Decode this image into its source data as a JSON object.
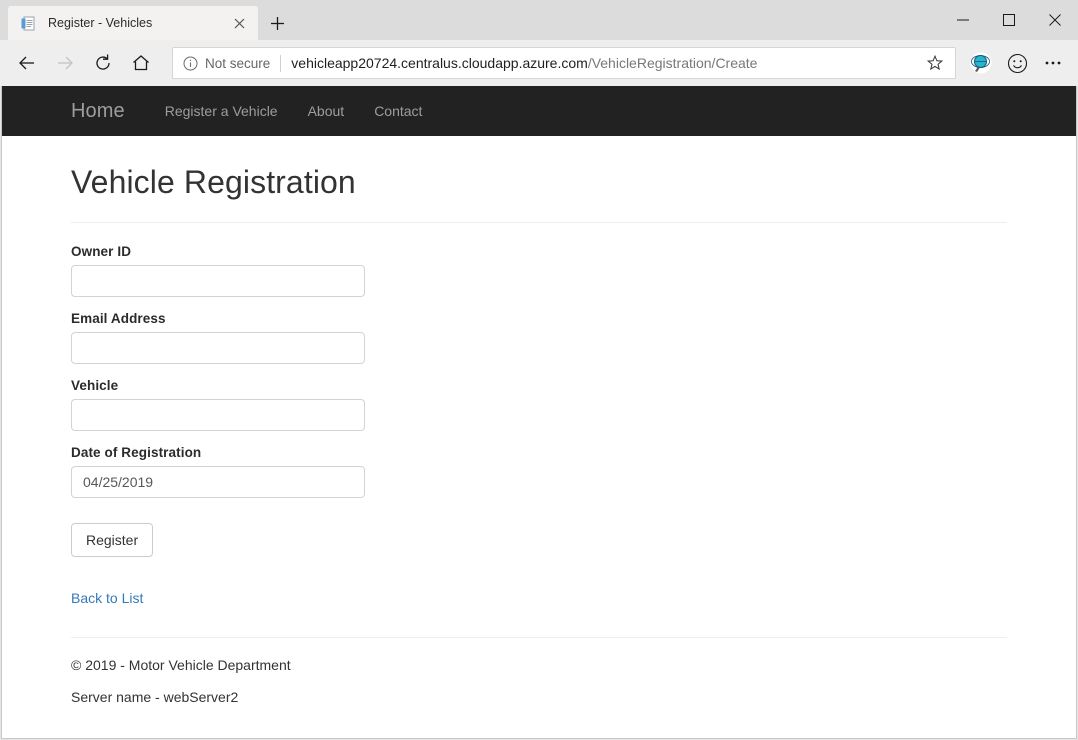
{
  "browser": {
    "tab": {
      "title": "Register - Vehicles",
      "favicon_icon": "page-document-icon",
      "close_icon": "close-icon"
    },
    "new_tab_label": "+",
    "window_controls": {
      "minimize_icon": "minimize-icon",
      "maximize_icon": "maximize-icon",
      "close_icon": "close-icon"
    },
    "nav": {
      "back_icon": "back-arrow-icon",
      "forward_icon": "forward-arrow-icon",
      "refresh_icon": "refresh-icon",
      "home_icon": "home-icon"
    },
    "address": {
      "security_icon": "info-circle-icon",
      "security_label": "Not secure",
      "url_host": "vehicleapp20724.centralus.cloudapp.azure.com",
      "url_path": "/VehicleRegistration/Create",
      "favorite_icon": "star-icon"
    },
    "toolbar_icons": {
      "extension_icon": "globe-extension-icon",
      "feedback_icon": "smiley-face-icon",
      "settings_icon": "ellipsis-more-icon"
    }
  },
  "site": {
    "brand": "Home",
    "nav_links": [
      {
        "label": "Register a Vehicle"
      },
      {
        "label": "About"
      },
      {
        "label": "Contact"
      }
    ]
  },
  "page": {
    "title": "Vehicle Registration",
    "form": {
      "fields": [
        {
          "label": "Owner ID",
          "value": "",
          "placeholder": ""
        },
        {
          "label": "Email Address",
          "value": "",
          "placeholder": ""
        },
        {
          "label": "Vehicle",
          "value": "",
          "placeholder": ""
        },
        {
          "label": "Date of Registration",
          "value": "04/25/2019",
          "placeholder": ""
        }
      ],
      "submit_label": "Register"
    },
    "back_link": "Back to List"
  },
  "footer": {
    "copyright": "© 2019 - Motor Vehicle Department",
    "server": "Server name - webServer2"
  },
  "colors": {
    "navbar_bg": "#222222",
    "navbar_text": "#9d9d9d",
    "link_blue": "#337ab7",
    "input_border": "#ced4da"
  }
}
